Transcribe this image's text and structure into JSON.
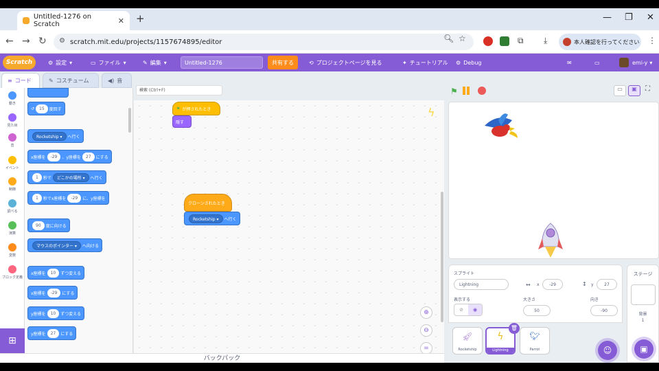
{
  "browser": {
    "tab_title": "Untitled-1276 on Scratch",
    "url": "scratch.mit.edu/projects/1157674895/editor",
    "verify_label": "本人確認を行ってください"
  },
  "menubar": {
    "logo": "Scratch",
    "settings": "設定",
    "file": "ファイル",
    "edit": "編集",
    "project_title": "Untitled-1276",
    "share": "共有する",
    "project_page": "プロジェクトページを見る",
    "tutorials": "チュートリアル",
    "debug": "Debug",
    "username": "emi-y"
  },
  "editor_tabs": {
    "code": "コード",
    "costume": "コスチューム",
    "sound": "音"
  },
  "search": {
    "placeholder": "検索 (Ctrl+F)"
  },
  "categories": [
    {
      "label": "動き",
      "color": "#4c97ff"
    },
    {
      "label": "見た目",
      "color": "#9966ff"
    },
    {
      "label": "音",
      "color": "#cf63cf"
    },
    {
      "label": "イベント",
      "color": "#ffbf00"
    },
    {
      "label": "制御",
      "color": "#ffab19"
    },
    {
      "label": "調べる",
      "color": "#5cb1d6"
    },
    {
      "label": "演算",
      "color": "#59c059"
    },
    {
      "label": "変数",
      "color": "#ff8c1a"
    },
    {
      "label": "ブロック定義",
      "color": "#ff6680"
    }
  ],
  "palette": {
    "turn_left": {
      "value": "15",
      "label": "度回す"
    },
    "goto": {
      "target": "Rocketship",
      "label": "へ行く"
    },
    "goto_xy": {
      "x_label": "x座標を",
      "x": "-29",
      "y_label": "、y座標を",
      "y": "27",
      "suffix": "にする"
    },
    "glide_to": {
      "secs": "1",
      "label1": "秒で",
      "target": "どこかの場所",
      "label2": "へ行く"
    },
    "glide_xy": {
      "secs": "1",
      "label1": "秒でx座標を",
      "x": "-29",
      "label2": "に、y座標を"
    },
    "point_dir": {
      "value": "90",
      "label": "度に向ける"
    },
    "point_towards": {
      "target": "マウスのポインター",
      "label": "へ向ける"
    },
    "change_x": {
      "label1": "x座標を",
      "value": "10",
      "label2": "ずつ変える"
    },
    "set_x": {
      "label1": "x座標を",
      "value": "-29",
      "label2": "にする"
    },
    "change_y": {
      "label1": "y座標を",
      "value": "10",
      "label2": "ずつ変える"
    },
    "set_y": {
      "label1": "y座標を",
      "value": "27",
      "label2": "にする"
    }
  },
  "workspace": {
    "flag_hat": "が押されたとき",
    "hide": "隠す",
    "clone_hat": "クローンされたとき",
    "goto_target": "Rocketship",
    "goto_label": "へ行く"
  },
  "backpack": "バックパック",
  "sprite_info": {
    "sprite_label": "スプライト",
    "name": "Lightning",
    "x_label": "x",
    "x": "-29",
    "y_label": "y",
    "y": "27",
    "show_label": "表示する",
    "size_label": "大きさ",
    "size": "50",
    "direction_label": "向き",
    "direction": "-90"
  },
  "sprites": [
    {
      "name": "Rocketship",
      "selected": false
    },
    {
      "name": "Lightning",
      "selected": true
    },
    {
      "name": "Parrot",
      "selected": false
    }
  ],
  "stage_panel": {
    "title": "ステージ",
    "backdrops_label": "背景",
    "backdrops_count": "1"
  }
}
